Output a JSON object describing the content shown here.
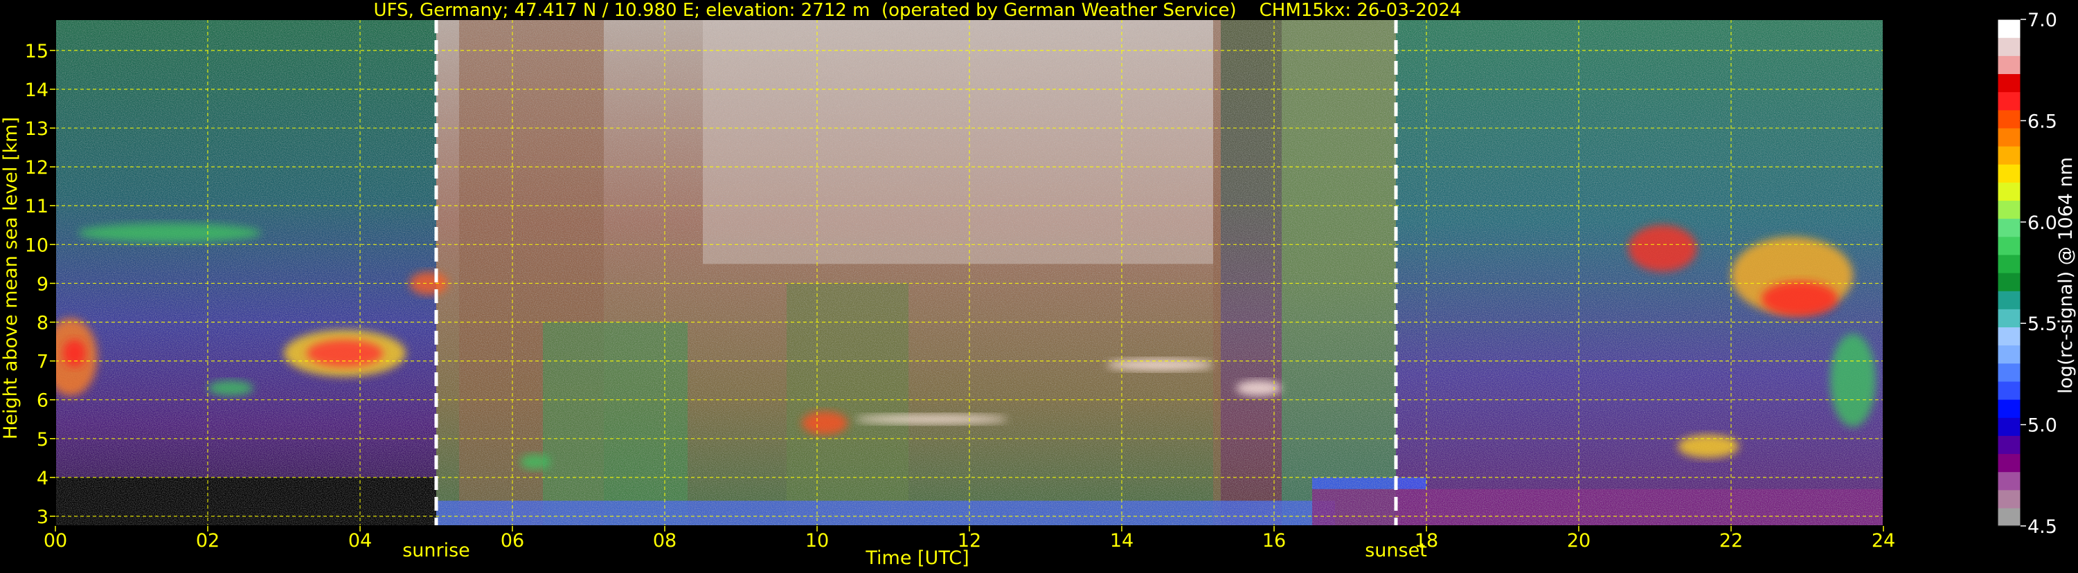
{
  "chart_data": {
    "type": "heatmap",
    "title": "UFS, Germany; 47.417 N / 10.980 E; elevation: 2712 m  (operated by German Weather Service)    CHM15kx: 26-03-2024",
    "xlabel": "Time [UTC]",
    "ylabel": "Height above mean sea level [km]",
    "xlim": [
      0,
      24
    ],
    "ylim": [
      2.75,
      15.8
    ],
    "x_ticks": [
      {
        "value": 0,
        "label": "00"
      },
      {
        "value": 2,
        "label": "02"
      },
      {
        "value": 4,
        "label": "04"
      },
      {
        "value": 6,
        "label": "06"
      },
      {
        "value": 8,
        "label": "08"
      },
      {
        "value": 10,
        "label": "10"
      },
      {
        "value": 12,
        "label": "12"
      },
      {
        "value": 14,
        "label": "14"
      },
      {
        "value": 16,
        "label": "16"
      },
      {
        "value": 18,
        "label": "18"
      },
      {
        "value": 20,
        "label": "20"
      },
      {
        "value": 22,
        "label": "22"
      },
      {
        "value": 24,
        "label": "24"
      }
    ],
    "y_ticks": [
      {
        "value": 3,
        "label": "3"
      },
      {
        "value": 4,
        "label": "4"
      },
      {
        "value": 5,
        "label": "5"
      },
      {
        "value": 6,
        "label": "6"
      },
      {
        "value": 7,
        "label": "7"
      },
      {
        "value": 8,
        "label": "8"
      },
      {
        "value": 9,
        "label": "9"
      },
      {
        "value": 10,
        "label": "10"
      },
      {
        "value": 11,
        "label": "11"
      },
      {
        "value": 12,
        "label": "12"
      },
      {
        "value": 13,
        "label": "13"
      },
      {
        "value": 14,
        "label": "14"
      },
      {
        "value": 15,
        "label": "15"
      }
    ],
    "grid": true,
    "markers": [
      {
        "label": "sunrise",
        "x": 5.0
      },
      {
        "label": "sunset",
        "x": 17.6
      }
    ],
    "colorbar": {
      "label": "log(rc-signal) @ 1064 nm",
      "range": [
        4.5,
        7.0
      ],
      "ticks": [
        {
          "value": 4.5,
          "label": "4.5"
        },
        {
          "value": 5.0,
          "label": "5.0"
        },
        {
          "value": 5.5,
          "label": "5.5"
        },
        {
          "value": 6.0,
          "label": "6.0"
        },
        {
          "value": 6.5,
          "label": "6.5"
        },
        {
          "value": 7.0,
          "label": "7.0"
        }
      ],
      "colors": [
        "#a0a0a0",
        "#b080a0",
        "#a050a0",
        "#800080",
        "#5000a0",
        "#1000d0",
        "#0010ff",
        "#3050ff",
        "#5080ff",
        "#80b0ff",
        "#a0c8ff",
        "#50c0c0",
        "#20a090",
        "#109030",
        "#20b040",
        "#40d060",
        "#60e080",
        "#a0f050",
        "#e0f820",
        "#ffe000",
        "#ffb000",
        "#ff8000",
        "#ff5000",
        "#ff2020",
        "#e00000",
        "#f0a0a0",
        "#e8d0d0",
        "#ffffff"
      ]
    },
    "colors": {
      "text": "#ffff00",
      "colorbar_text": "#ffffff",
      "grid": "#ffff00",
      "marker": "#ffffff",
      "background": "#000000"
    }
  }
}
